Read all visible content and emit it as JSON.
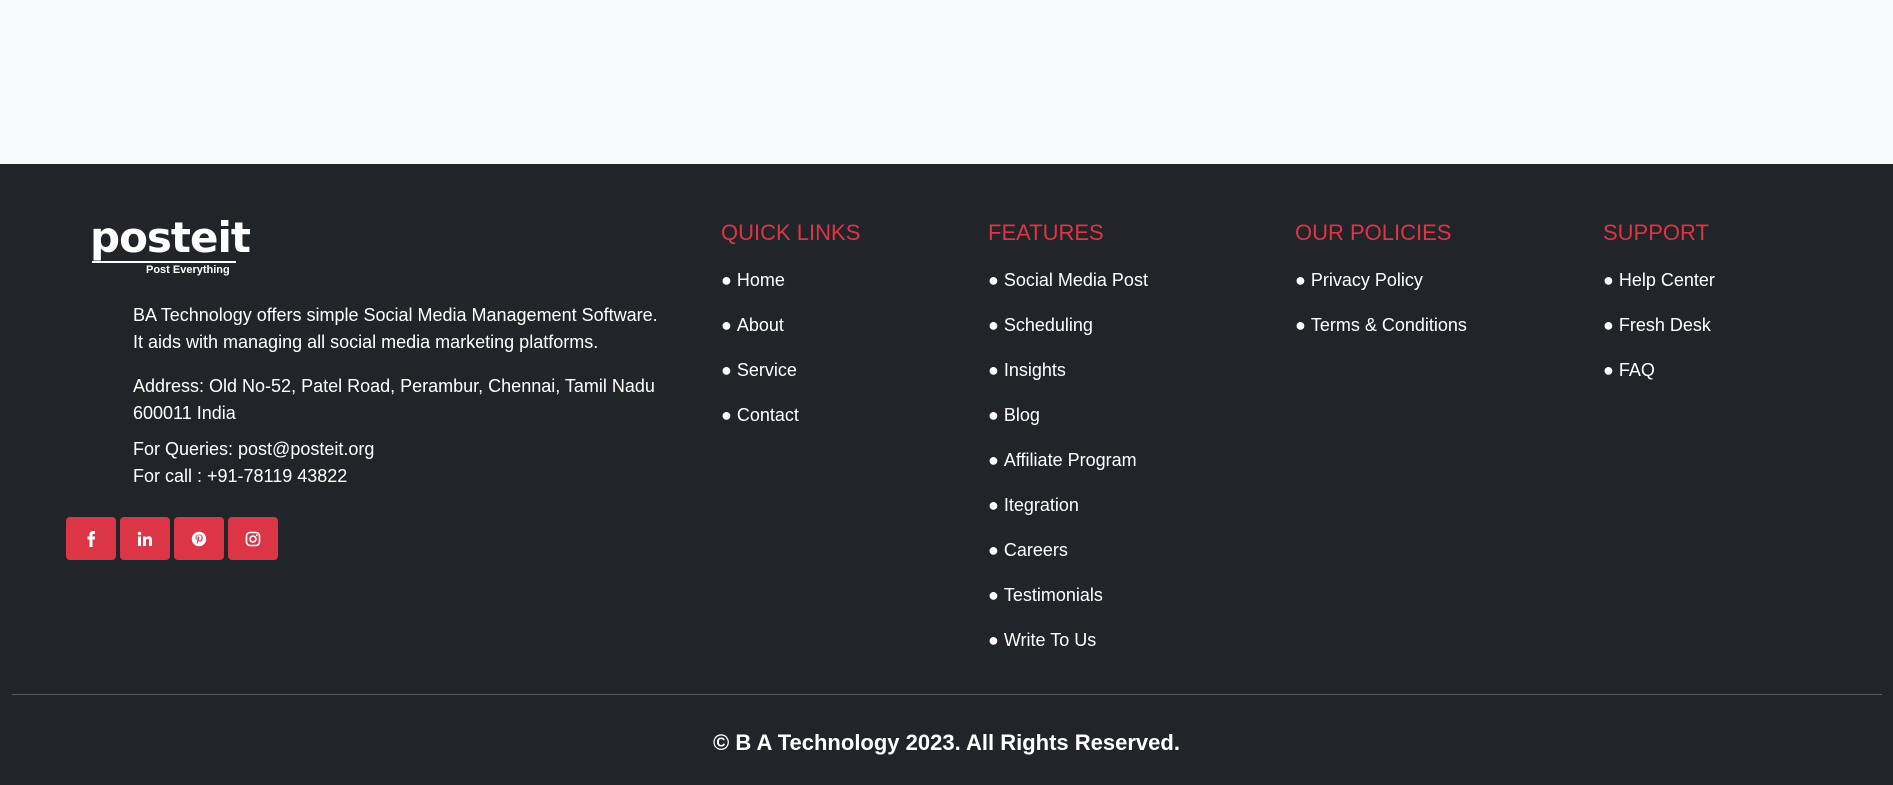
{
  "brand": {
    "logo_text": "posteit",
    "tagline": "Post Everything"
  },
  "about": {
    "description_line1": "BA Technology offers simple Social Media Management Software.",
    "description_line2": "It aids with managing all social media marketing platforms.",
    "address_line1": "Address: Old No-52, Patel Road, Perambur, Chennai, Tamil Nadu",
    "address_line2": "600011 India",
    "queries": "For Queries: post@posteit.org",
    "call": "For call : +91-78119 43822"
  },
  "social": [
    {
      "icon": "facebook-icon",
      "glyph": "f"
    },
    {
      "icon": "linkedin-icon",
      "glyph": "in"
    },
    {
      "icon": "pinterest-icon",
      "glyph": "p"
    },
    {
      "icon": "instagram-icon",
      "glyph": "ig"
    }
  ],
  "quick_links": {
    "title": "QUICK LINKS",
    "items": [
      "Home",
      "About",
      "Service",
      "Contact"
    ]
  },
  "features": {
    "title": "FEATURES",
    "items": [
      "Social Media Post",
      "Scheduling",
      "Insights",
      "Blog",
      "Affiliate Program",
      "Itegration",
      "Careers",
      "Testimonials",
      "Write To Us"
    ]
  },
  "policies": {
    "title": "OUR POLICIES",
    "items": [
      "Privacy Policy",
      "Terms & Conditions"
    ]
  },
  "support": {
    "title": "SUPPORT",
    "items": [
      "Help Center",
      "Fresh Desk",
      "FAQ"
    ]
  },
  "bullet": "●",
  "copyright": "© B A Technology 2023. All Rights Reserved.",
  "colors": {
    "footer_bg": "#212529",
    "accent": "#dc3545",
    "page_bg": "#f8f9fa"
  }
}
